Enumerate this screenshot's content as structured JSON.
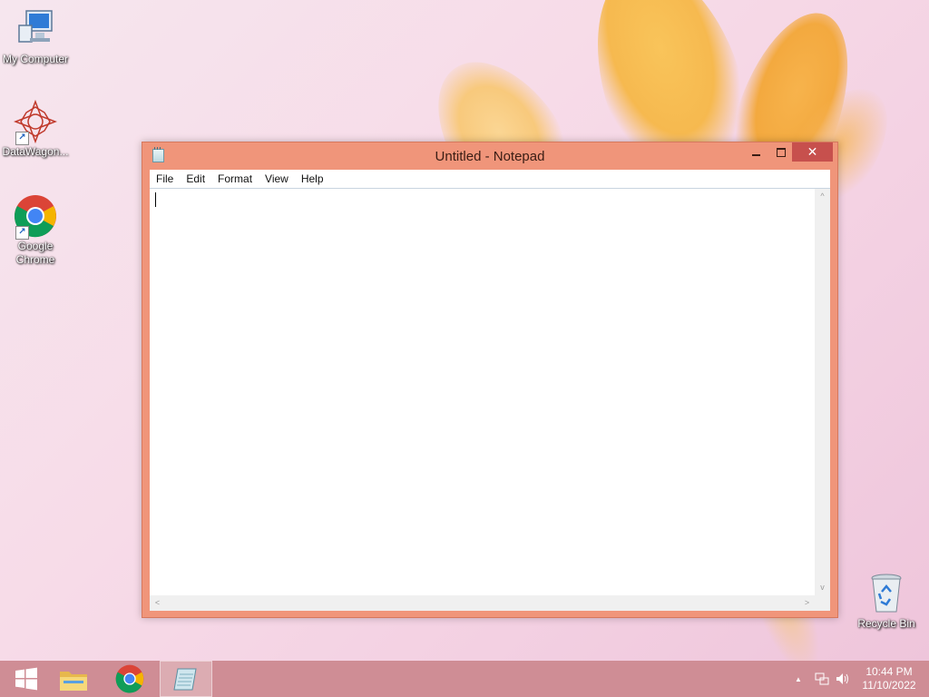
{
  "desktop": {
    "icons": [
      {
        "label": "My Computer",
        "icon": "computer-icon"
      },
      {
        "label": "DataWagon...",
        "icon": "datawagon-icon"
      },
      {
        "label": "Google Chrome",
        "icon": "chrome-icon"
      },
      {
        "label": "Recycle Bin",
        "icon": "recycle-bin-icon"
      }
    ]
  },
  "window": {
    "title": "Untitled - Notepad",
    "close_glyph": "✕",
    "menu": [
      "File",
      "Edit",
      "Format",
      "View",
      "Help"
    ],
    "content": ""
  },
  "taskbar": {
    "items": [
      {
        "name": "start-button",
        "icon": "windows-logo-icon"
      },
      {
        "name": "file-explorer",
        "icon": "folder-icon"
      },
      {
        "name": "google-chrome",
        "icon": "chrome-icon"
      },
      {
        "name": "notepad",
        "icon": "notepad-icon",
        "active": true
      }
    ],
    "tray_arrow": "▲",
    "clock": {
      "time": "10:44 PM",
      "date": "11/10/2022"
    }
  },
  "colors": {
    "window_frame": "#f0957a",
    "close_button": "#c7504d",
    "taskbar": "#cf8d95"
  }
}
